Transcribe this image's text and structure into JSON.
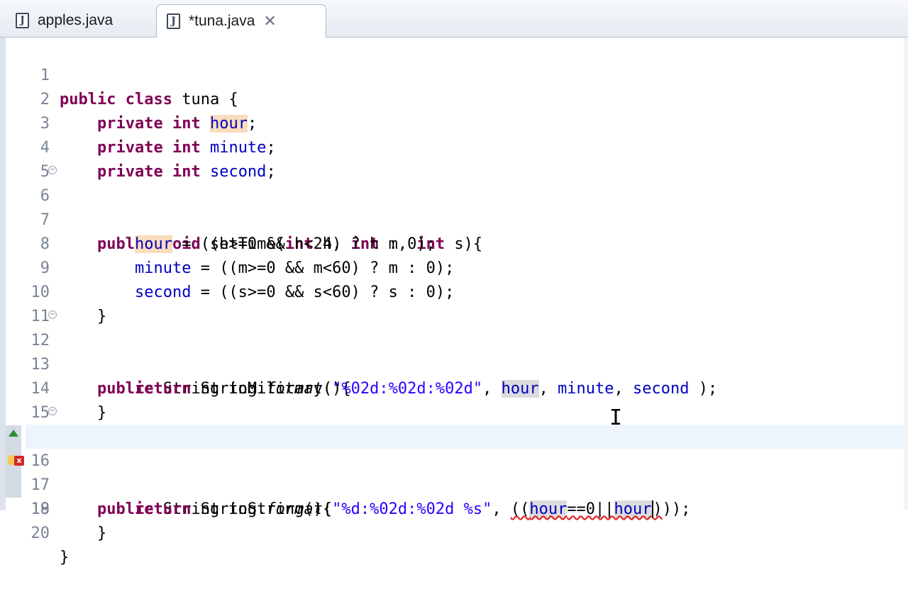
{
  "tabs": [
    {
      "label": "apples.java",
      "icon": "java-file-icon",
      "active": false
    },
    {
      "label": "*tuna.java",
      "icon": "java-file-icon",
      "active": true,
      "close": "✕"
    }
  ],
  "java_icon_glyph": "J",
  "editor": {
    "lines": [
      {
        "n": "1"
      },
      {
        "n": "2"
      },
      {
        "n": "3"
      },
      {
        "n": "4"
      },
      {
        "n": "5"
      },
      {
        "n": "6"
      },
      {
        "n": "7"
      },
      {
        "n": "8"
      },
      {
        "n": "9"
      },
      {
        "n": "10"
      },
      {
        "n": "11"
      },
      {
        "n": "12"
      },
      {
        "n": "13"
      },
      {
        "n": "14"
      },
      {
        "n": "15"
      },
      {
        "n": "16"
      },
      {
        "n": "17"
      },
      {
        "n": "18"
      },
      {
        "n": "19"
      },
      {
        "n": "20"
      }
    ],
    "code": {
      "l1": {
        "kw1": "public",
        "kw2": "class",
        "rest": " tuna {"
      },
      "l2": {
        "kw1": "private",
        "kw2": "int",
        "field": "hour",
        "end": ";"
      },
      "l3": {
        "kw1": "private",
        "kw2": "int",
        "field": "minute",
        "end": ";"
      },
      "l4": {
        "kw1": "private",
        "kw2": "int",
        "field": "second",
        "end": ";"
      },
      "l6": {
        "kw1": "public",
        "kw2": "void",
        "name": " setTime(",
        "kw3": "int",
        "a": " h, ",
        "kw4": "int",
        "b": " m, ",
        "kw5": "int",
        "c": " s){"
      },
      "l7": {
        "field": "hour",
        "rest": " = ((h>=0 && h<24) ? h : 0);"
      },
      "l8": {
        "field": "minute",
        "rest": " = ((m>=0 && m<60) ? m : 0);"
      },
      "l9": {
        "field": "second",
        "rest": " = ((s>=0 && s<60) ? s : 0);"
      },
      "l10": {
        "rest": "}"
      },
      "l12": {
        "kw1": "public",
        "rest": " String toMilitary(){"
      },
      "l13": {
        "kw1": "return",
        "pre": " String.",
        "method": "format",
        "open": "(",
        "str": "\"%02d:%02d:%02d\"",
        "comma": ", ",
        "f1": "hour",
        "c1": ", ",
        "f2": "minute",
        "c2": ", ",
        "f3": "second",
        "end": " );"
      },
      "l14": {
        "rest": "}"
      },
      "l16": {
        "kw1": "public",
        "rest": " String toString(){"
      },
      "l17": {
        "kw1": "return",
        "pre": " String.",
        "method": "format",
        "open": "(",
        "str": "\"%d:%02d:%02d %s\"",
        "comma": ", ",
        "sq1": "((",
        "f1": "hour",
        "op": "==0||",
        "f2": "hour",
        "sq2": ")",
        "end": "));"
      },
      "l18": {
        "rest": "}"
      },
      "l20": {
        "rest": "}"
      }
    }
  },
  "markers": {
    "line16": "warning-arrow",
    "line17": "error-marker"
  }
}
